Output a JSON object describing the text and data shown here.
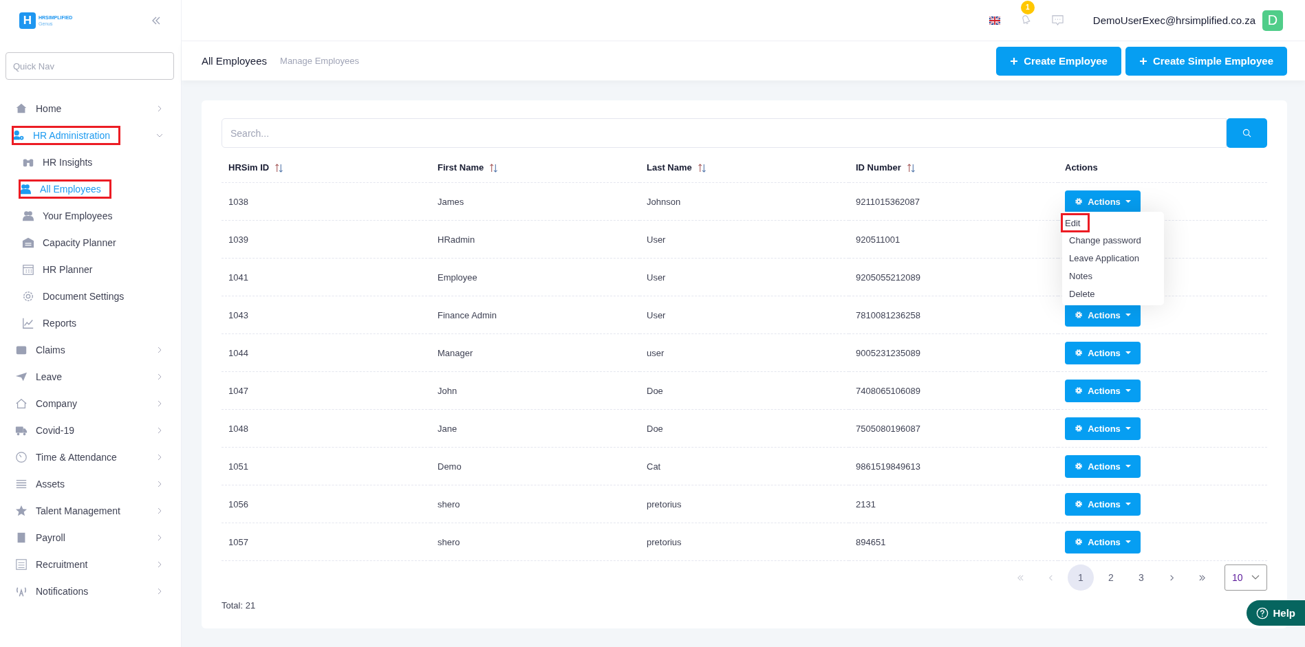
{
  "logo": {
    "name": "HRSIMPLIFIED",
    "subtitle": "Genus",
    "letters": "H"
  },
  "quick_nav": {
    "placeholder": "Quick Nav"
  },
  "sidebar": {
    "items": [
      {
        "label": "Home",
        "expanded": false,
        "selected": false,
        "annotated": false
      },
      {
        "label": "HR Administration",
        "expanded": true,
        "selected": true,
        "annotated": true,
        "children": [
          {
            "label": "HR Insights",
            "selected": false,
            "annotated": false
          },
          {
            "label": "All Employees",
            "selected": true,
            "annotated": true
          },
          {
            "label": "Your Employees",
            "selected": false,
            "annotated": false
          },
          {
            "label": "Capacity Planner",
            "selected": false,
            "annotated": false
          },
          {
            "label": "HR Planner",
            "selected": false,
            "annotated": false
          },
          {
            "label": "Document Settings",
            "selected": false,
            "annotated": false
          },
          {
            "label": "Reports",
            "selected": false,
            "annotated": false
          }
        ]
      },
      {
        "label": "Claims",
        "expanded": false,
        "selected": false,
        "annotated": false
      },
      {
        "label": "Leave",
        "expanded": false,
        "selected": false,
        "annotated": false
      },
      {
        "label": "Company",
        "expanded": false,
        "selected": false,
        "annotated": false
      },
      {
        "label": "Covid-19",
        "expanded": false,
        "selected": false,
        "annotated": false
      },
      {
        "label": "Time & Attendance",
        "expanded": false,
        "selected": false,
        "annotated": false
      },
      {
        "label": "Assets",
        "expanded": false,
        "selected": false,
        "annotated": false
      },
      {
        "label": "Talent Management",
        "expanded": false,
        "selected": false,
        "annotated": false
      },
      {
        "label": "Payroll",
        "expanded": false,
        "selected": false,
        "annotated": false
      },
      {
        "label": "Recruitment",
        "expanded": false,
        "selected": false,
        "annotated": false
      },
      {
        "label": "Notifications",
        "expanded": false,
        "selected": false,
        "annotated": false
      }
    ]
  },
  "topbar": {
    "notification_count": "1",
    "user_email": "DemoUserExec@hrsimplified.co.za",
    "avatar": "D"
  },
  "page_header": {
    "title": "All Employees",
    "breadcrumb": "Manage Employees",
    "buttons": [
      {
        "label": "Create Employee"
      },
      {
        "label": "Create Simple Employee"
      }
    ]
  },
  "search": {
    "placeholder": "Search..."
  },
  "table": {
    "columns": [
      {
        "label": "HRSim ID",
        "sortable": true
      },
      {
        "label": "First Name",
        "sortable": true
      },
      {
        "label": "Last Name",
        "sortable": true
      },
      {
        "label": "ID Number",
        "sortable": true
      },
      {
        "label": "Actions",
        "sortable": false
      }
    ],
    "rows": [
      {
        "cells": [
          "1038",
          "James",
          "Johnson",
          "9211015362087"
        ],
        "action": "Actions",
        "action_menu": {
          "items": [
            {
              "label": "Edit",
              "annotated": true
            },
            {
              "label": "Change password",
              "annotated": false
            },
            {
              "label": "Leave Application",
              "annotated": false
            },
            {
              "label": "Notes",
              "annotated": false
            },
            {
              "label": "Delete",
              "annotated": false
            }
          ]
        }
      },
      {
        "cells": [
          "1039",
          "HRadmin",
          "User",
          "920511001"
        ]
      },
      {
        "cells": [
          "1041",
          "Employee",
          "User",
          "9205055212089"
        ]
      },
      {
        "cells": [
          "1043",
          "Finance Admin",
          "User",
          "7810081236258"
        ],
        "action": "Actions"
      },
      {
        "cells": [
          "1044",
          "Manager",
          "user",
          "9005231235089"
        ],
        "action": "Actions"
      },
      {
        "cells": [
          "1047",
          "John",
          "Doe",
          "7408065106089"
        ],
        "action": "Actions"
      },
      {
        "cells": [
          "1048",
          "Jane",
          "Doe",
          "7505080196087"
        ],
        "action": "Actions"
      },
      {
        "cells": [
          "1051",
          "Demo",
          "Cat",
          "9861519849613"
        ],
        "action": "Actions"
      },
      {
        "cells": [
          "1056",
          "shero",
          "pretorius",
          "2131"
        ],
        "action": "Actions"
      },
      {
        "cells": [
          "1057",
          "shero",
          "pretorius",
          "894651"
        ],
        "action": "Actions"
      }
    ]
  },
  "pagination": {
    "first": {
      "disabled": true
    },
    "prev": {
      "disabled": true
    },
    "pages": [
      {
        "label": "1",
        "selected": true
      },
      {
        "label": "2",
        "selected": false
      },
      {
        "label": "3",
        "selected": false
      }
    ],
    "next": {
      "disabled": false
    },
    "last": {
      "disabled": false
    },
    "page_size": "10"
  },
  "total": "Total: 21",
  "help": {
    "label": "Help"
  }
}
